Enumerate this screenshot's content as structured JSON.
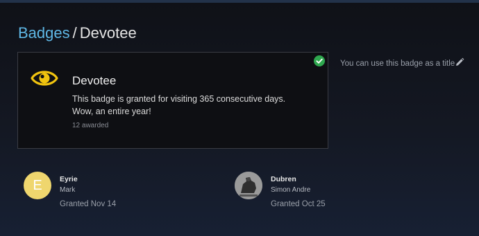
{
  "breadcrumb": {
    "parent": "Badges",
    "separator": "/",
    "current": "Devotee"
  },
  "badge": {
    "icon": "eye-icon",
    "icon_color": "#f1c40f",
    "granted_indicator": "check-circle-icon",
    "granted_color": "#2fa84f",
    "name": "Devotee",
    "description": "This badge is granted for visiting 365 consecutive days. Wow, an entire year!",
    "awarded": "12 awarded"
  },
  "title_option": {
    "text": "You can use this badge as a title",
    "icon": "pencil-icon"
  },
  "grantees": [
    {
      "avatar_letter": "E",
      "avatar_color": "#efd66e",
      "name": "Eyrie",
      "username": "Mark",
      "granted": "Granted Nov 14"
    },
    {
      "avatar_letter": "",
      "name": "Dubren",
      "username": "Simon Andre",
      "granted": "Granted Oct 25"
    }
  ],
  "colors": {
    "link": "#5fb8e6",
    "background": "#111318",
    "card_border": "#3a3c44"
  }
}
